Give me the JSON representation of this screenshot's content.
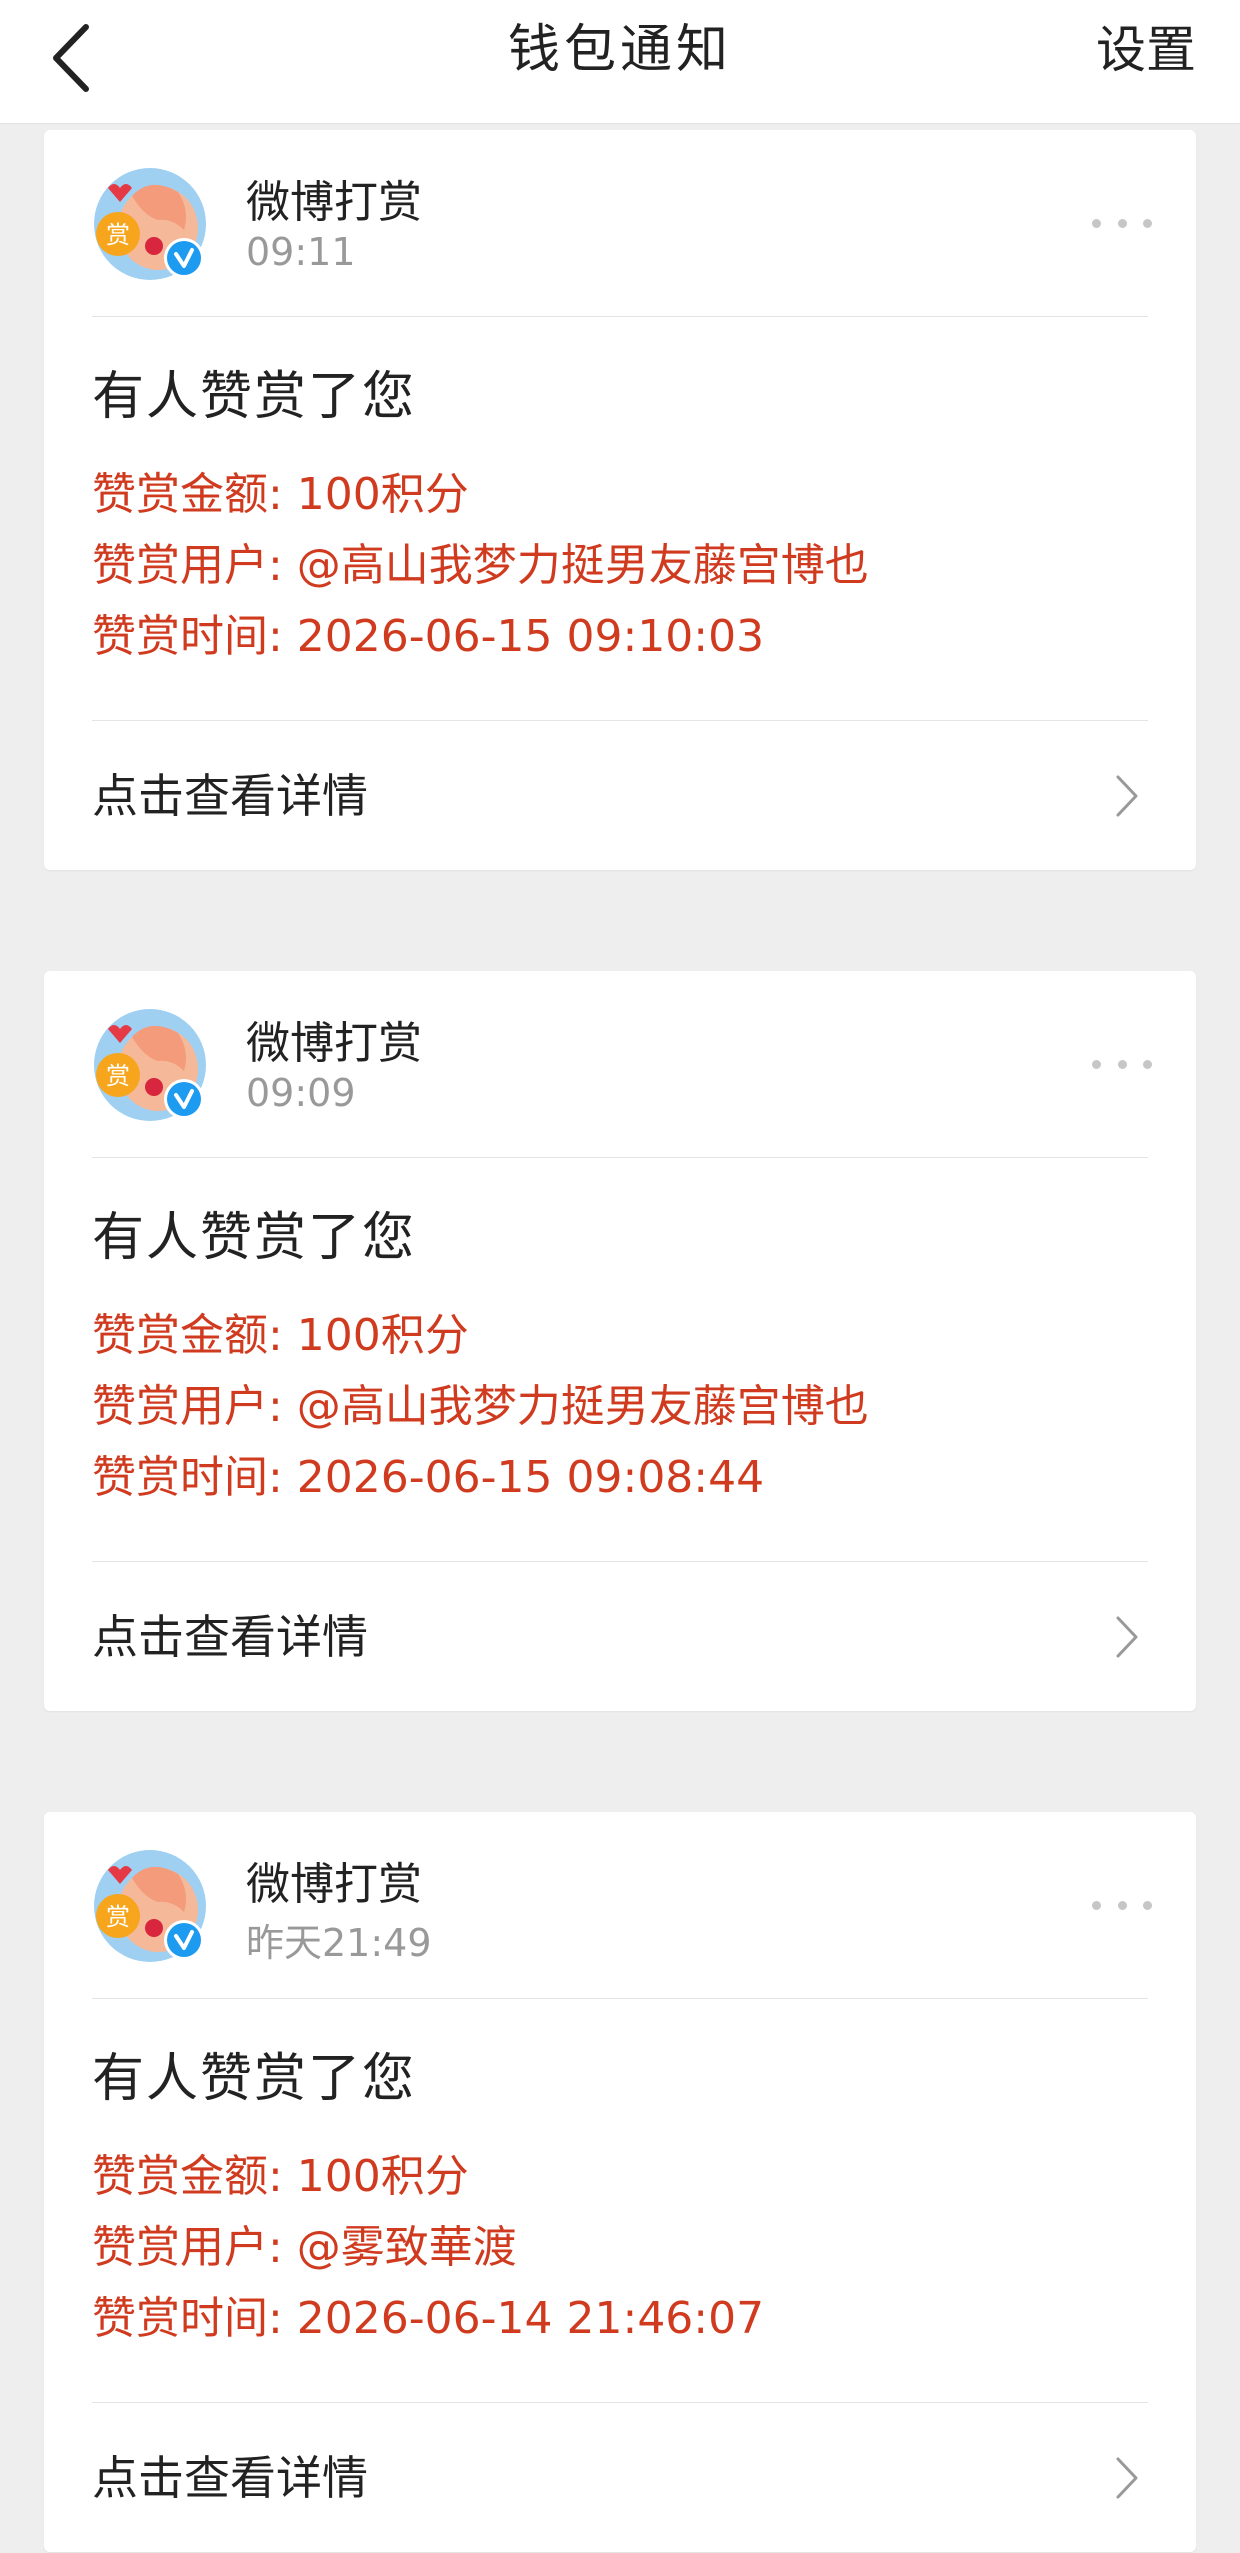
{
  "navbar": {
    "title": "钱包通知",
    "settings_label": "设置"
  },
  "avatar": {
    "badge_text": "赏"
  },
  "cards": [
    {
      "sender": "微博打赏",
      "time": "09:11",
      "title": "有人赞赏了您",
      "amount": "赞赏金额: 100积分",
      "user": "赞赏用户: @高山我梦力挺男友藤宫博也",
      "datetime": "赞赏时间: 2026-06-15 09:10:03",
      "footer": "点击查看详情"
    },
    {
      "sender": "微博打赏",
      "time": "09:09",
      "title": "有人赞赏了您",
      "amount": "赞赏金额: 100积分",
      "user": "赞赏用户: @高山我梦力挺男友藤宫博也",
      "datetime": "赞赏时间: 2026-06-15 09:08:44",
      "footer": "点击查看详情"
    },
    {
      "sender": "微博打赏",
      "time": "昨天21:49",
      "title": "有人赞赏了您",
      "amount": "赞赏金额: 100积分",
      "user": "赞赏用户: @雾致華渡",
      "datetime": "赞赏时间: 2026-06-14 21:46:07",
      "footer": "点击查看详情"
    }
  ],
  "colors": {
    "detail_text": "#d03b1f",
    "verified_badge": "#1d9bf0"
  }
}
